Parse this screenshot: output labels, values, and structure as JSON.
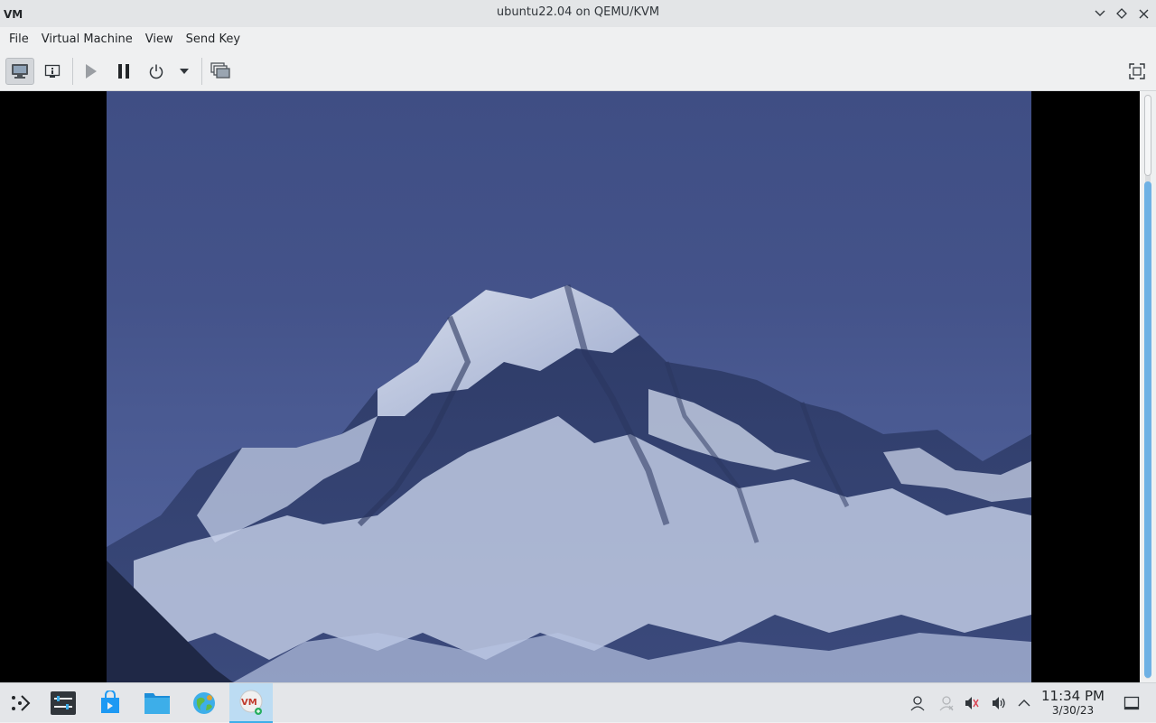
{
  "window": {
    "title": "ubuntu22.04 on QEMU/KVM",
    "app_icon": "virt-manager-icon"
  },
  "window_controls": [
    "minimize-icon",
    "maximize-icon",
    "close-icon"
  ],
  "menu": {
    "items": [
      "File",
      "Virtual Machine",
      "View",
      "Send Key"
    ]
  },
  "toolbar": {
    "buttons": [
      {
        "icon": "console-icon",
        "active": true
      },
      {
        "icon": "details-icon",
        "active": false
      },
      {
        "icon": "run-icon",
        "active": false,
        "disabled": true
      },
      {
        "icon": "pause-icon",
        "active": false
      },
      {
        "icon": "power-icon",
        "active": false
      },
      {
        "icon": "dropdown-arrow-icon",
        "active": false
      },
      {
        "icon": "snapshots-icon",
        "active": false
      },
      {
        "icon": "fullscreen-icon",
        "active": false
      }
    ]
  },
  "guest_display": {
    "content": "mountain-wallpaper"
  },
  "taskbar": {
    "apps": [
      {
        "icon": "app-launcher-icon"
      },
      {
        "icon": "system-settings-icon"
      },
      {
        "icon": "discover-store-icon"
      },
      {
        "icon": "file-manager-icon"
      },
      {
        "icon": "web-browser-icon"
      },
      {
        "icon": "virt-manager-icon",
        "active": true
      }
    ],
    "tray": [
      "user-icon",
      "network-icon",
      "muted-mic-icon",
      "volume-icon",
      "tray-expand-icon",
      "show-desktop-icon"
    ],
    "clock": {
      "time": "11:34 PM",
      "date": "3/30/23"
    }
  },
  "colors": {
    "accent": "#3daee9",
    "sky": "#44538a",
    "snow": "#dfe6f4"
  }
}
